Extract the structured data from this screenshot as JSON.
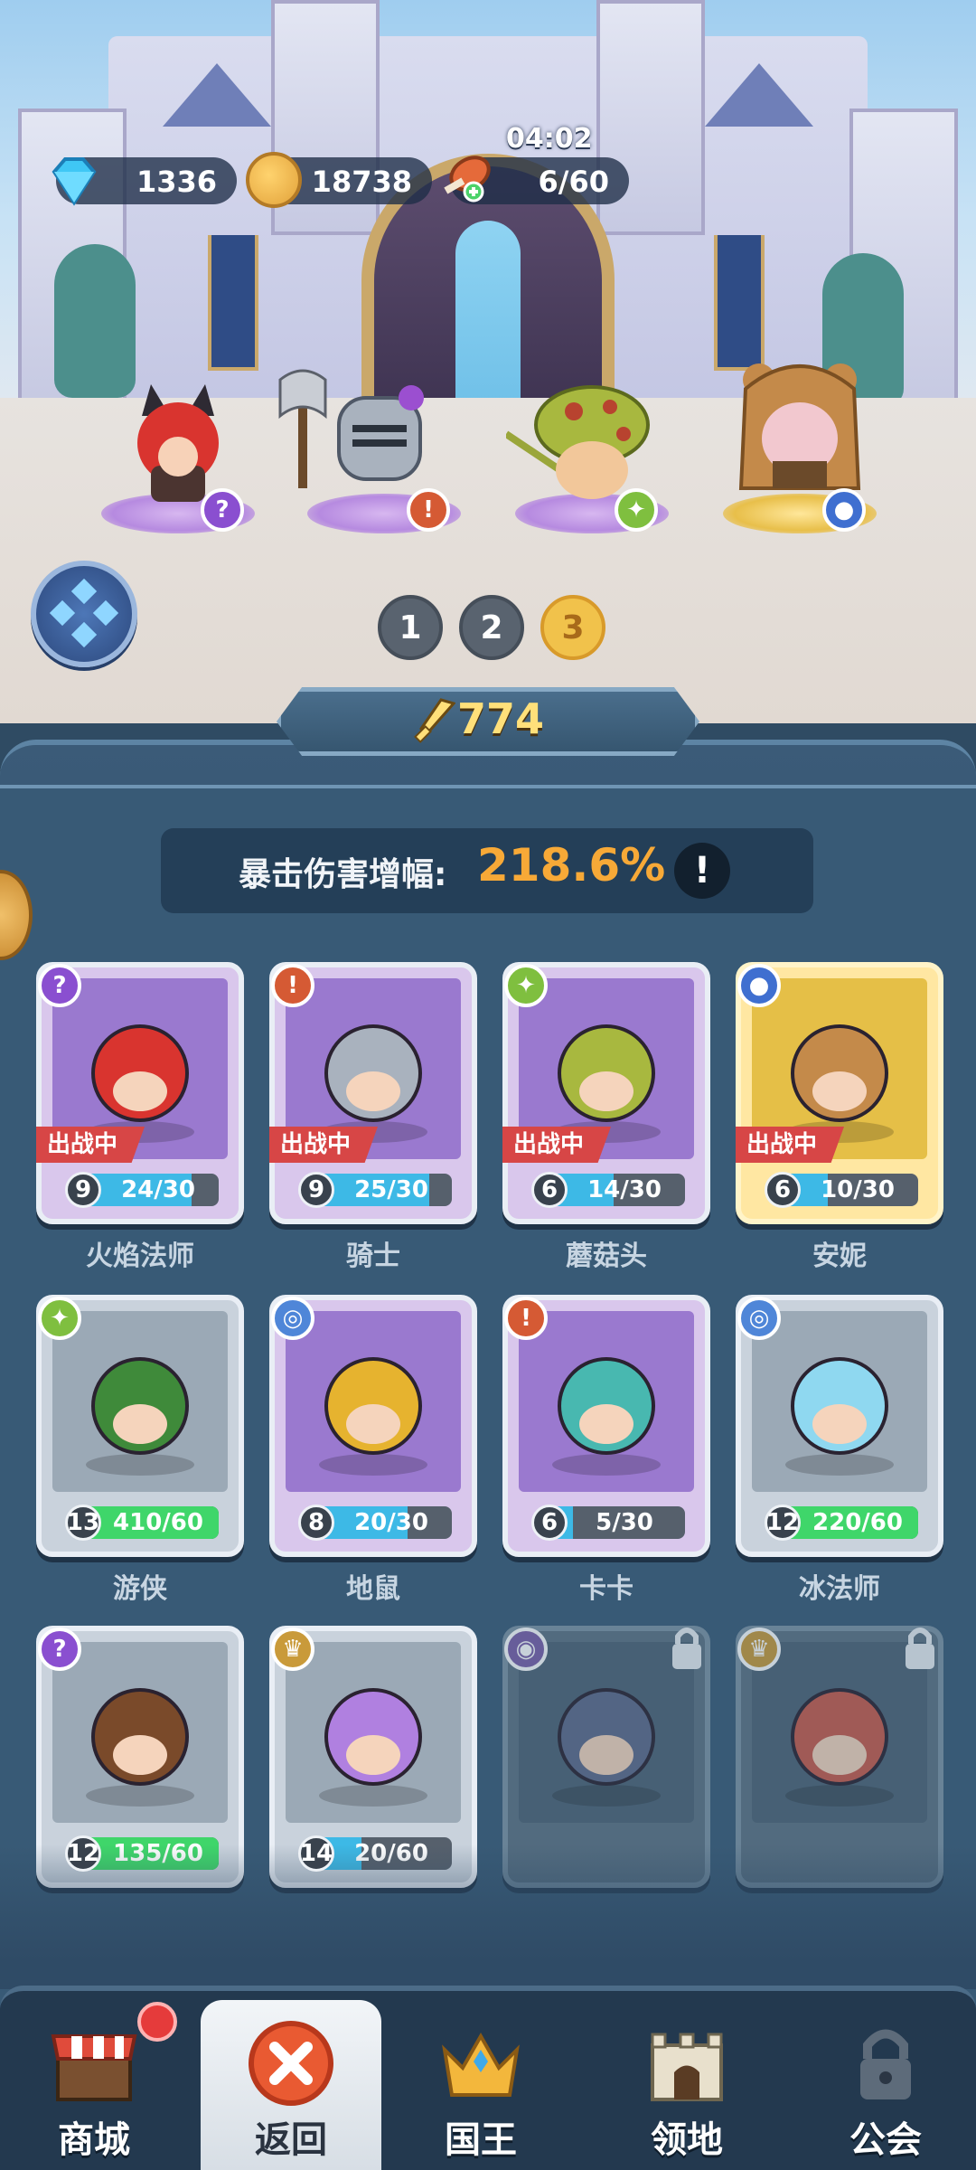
{
  "resources": {
    "gems": "1336",
    "coins": "18738",
    "stamina": "6/60",
    "stamina_timer": "04:02"
  },
  "team_tabs": [
    "1",
    "2",
    "3"
  ],
  "active_team": "3",
  "power": "774",
  "crit": {
    "label": "暴击伤害增幅:",
    "value": "218.6%",
    "info": "!"
  },
  "deploy_label": "出战中",
  "heroes": [
    {
      "name": "火焰法师",
      "level": "9",
      "progress": "24/30",
      "fill": 0.8,
      "style": "purple",
      "class_icon": "staff-icon",
      "deployed": true
    },
    {
      "name": "骑士",
      "level": "9",
      "progress": "25/30",
      "fill": 0.83,
      "style": "purple",
      "class_icon": "sword-class-icon",
      "deployed": true
    },
    {
      "name": "蘑菇头",
      "level": "6",
      "progress": "14/30",
      "fill": 0.47,
      "style": "purple",
      "class_icon": "constellation-icon",
      "deployed": true
    },
    {
      "name": "安妮",
      "level": "6",
      "progress": "10/30",
      "fill": 0.33,
      "style": "gold",
      "class_icon": "paw-icon",
      "deployed": true
    },
    {
      "name": "游侠",
      "level": "13",
      "progress": "410/60",
      "fill": 1.0,
      "style": "grey",
      "class_icon": "constellation-icon",
      "deployed": false
    },
    {
      "name": "地鼠",
      "level": "8",
      "progress": "20/30",
      "fill": 0.67,
      "style": "purple",
      "class_icon": "swirl-icon",
      "deployed": false
    },
    {
      "name": "卡卡",
      "level": "6",
      "progress": "5/30",
      "fill": 0.17,
      "style": "purple",
      "class_icon": "sword-class-icon",
      "deployed": false
    },
    {
      "name": "冰法师",
      "level": "12",
      "progress": "220/60",
      "fill": 1.0,
      "style": "grey",
      "class_icon": "swirl-icon",
      "deployed": false
    },
    {
      "name": "",
      "level": "12",
      "progress": "135/60",
      "fill": 1.0,
      "style": "grey",
      "class_icon": "staff-icon",
      "deployed": false
    },
    {
      "name": "",
      "level": "14",
      "progress": "20/60",
      "fill": 0.33,
      "style": "grey",
      "class_icon": "crown-wing-icon",
      "deployed": false
    },
    {
      "name": "",
      "level": "",
      "progress": "",
      "fill": 0,
      "style": "locked",
      "class_icon": "eye-icon",
      "deployed": false
    },
    {
      "name": "",
      "level": "",
      "progress": "",
      "fill": 0,
      "style": "locked",
      "class_icon": "crown-wing-icon",
      "deployed": false
    }
  ],
  "nav": {
    "shop": "商城",
    "back": "返回",
    "king": "国王",
    "territory": "领地",
    "guild": "公会"
  },
  "colors": {
    "panel": "#385a76",
    "accent_orange": "#f7a937",
    "deploy_red": "#d74646",
    "power_gold": "#ffe07a"
  }
}
